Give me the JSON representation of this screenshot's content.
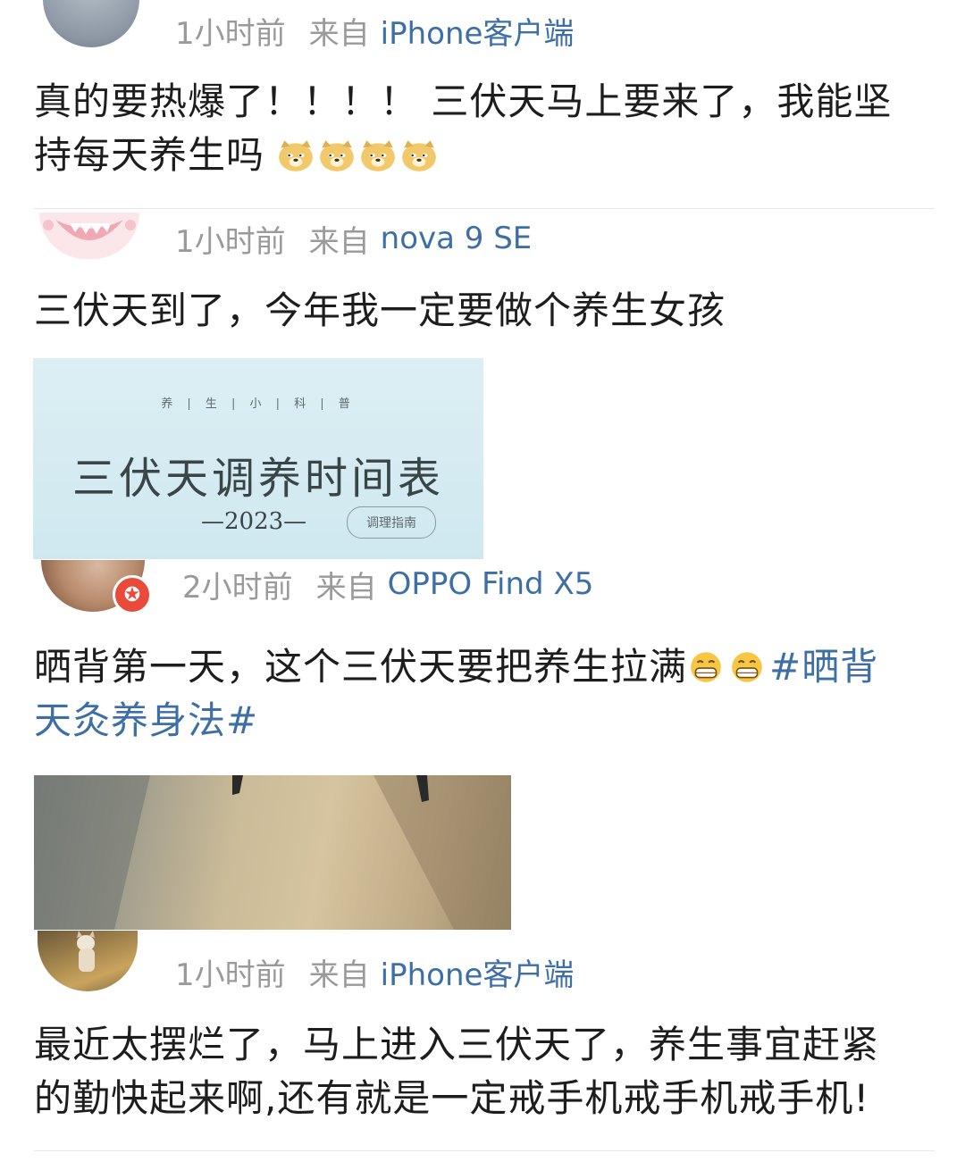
{
  "posts": [
    {
      "time": "1小时前",
      "from": "来自",
      "source": "iPhone客户端",
      "content_line1": "真的要热爆了！！！！ 三伏天马上要来了，我能坚",
      "content_line2": "持每天养生吗",
      "emoji_icons": [
        "doge-emoji",
        "doge-emoji",
        "doge-emoji",
        "doge-emoji"
      ]
    },
    {
      "time": "1小时前",
      "from": "来自",
      "source": "nova 9 SE",
      "content_line1": "三伏天到了，今年我一定要做个养生女孩",
      "image": {
        "subtitle": "养 | 生 | 小 | 科 | 普",
        "title": "三伏天调养时间表",
        "year": "—2023—",
        "tag": "调理指南"
      }
    },
    {
      "time": "2小时前",
      "from": "来自",
      "source": "OPPO Find X5",
      "content_line1": "晒背第一天，这个三伏天要把养生拉满",
      "hashtag_part1": "#晒背",
      "hashtag_part2": "天灸养身法#",
      "emoji_icons": [
        "grin-emoji",
        "grin-emoji"
      ]
    },
    {
      "time": "1小时前",
      "from": "来自",
      "source": "iPhone客户端",
      "content_line1": "最近太摆烂了，马上进入三伏天了，养生事宜赶紧",
      "content_line2": "的勤快起来啊,还有就是一定戒手机戒手机戒手机!"
    }
  ],
  "colors": {
    "source_link": "#3d6fa6",
    "meta_gray": "#9a9a9a",
    "badge_red": "#e94a3a"
  }
}
